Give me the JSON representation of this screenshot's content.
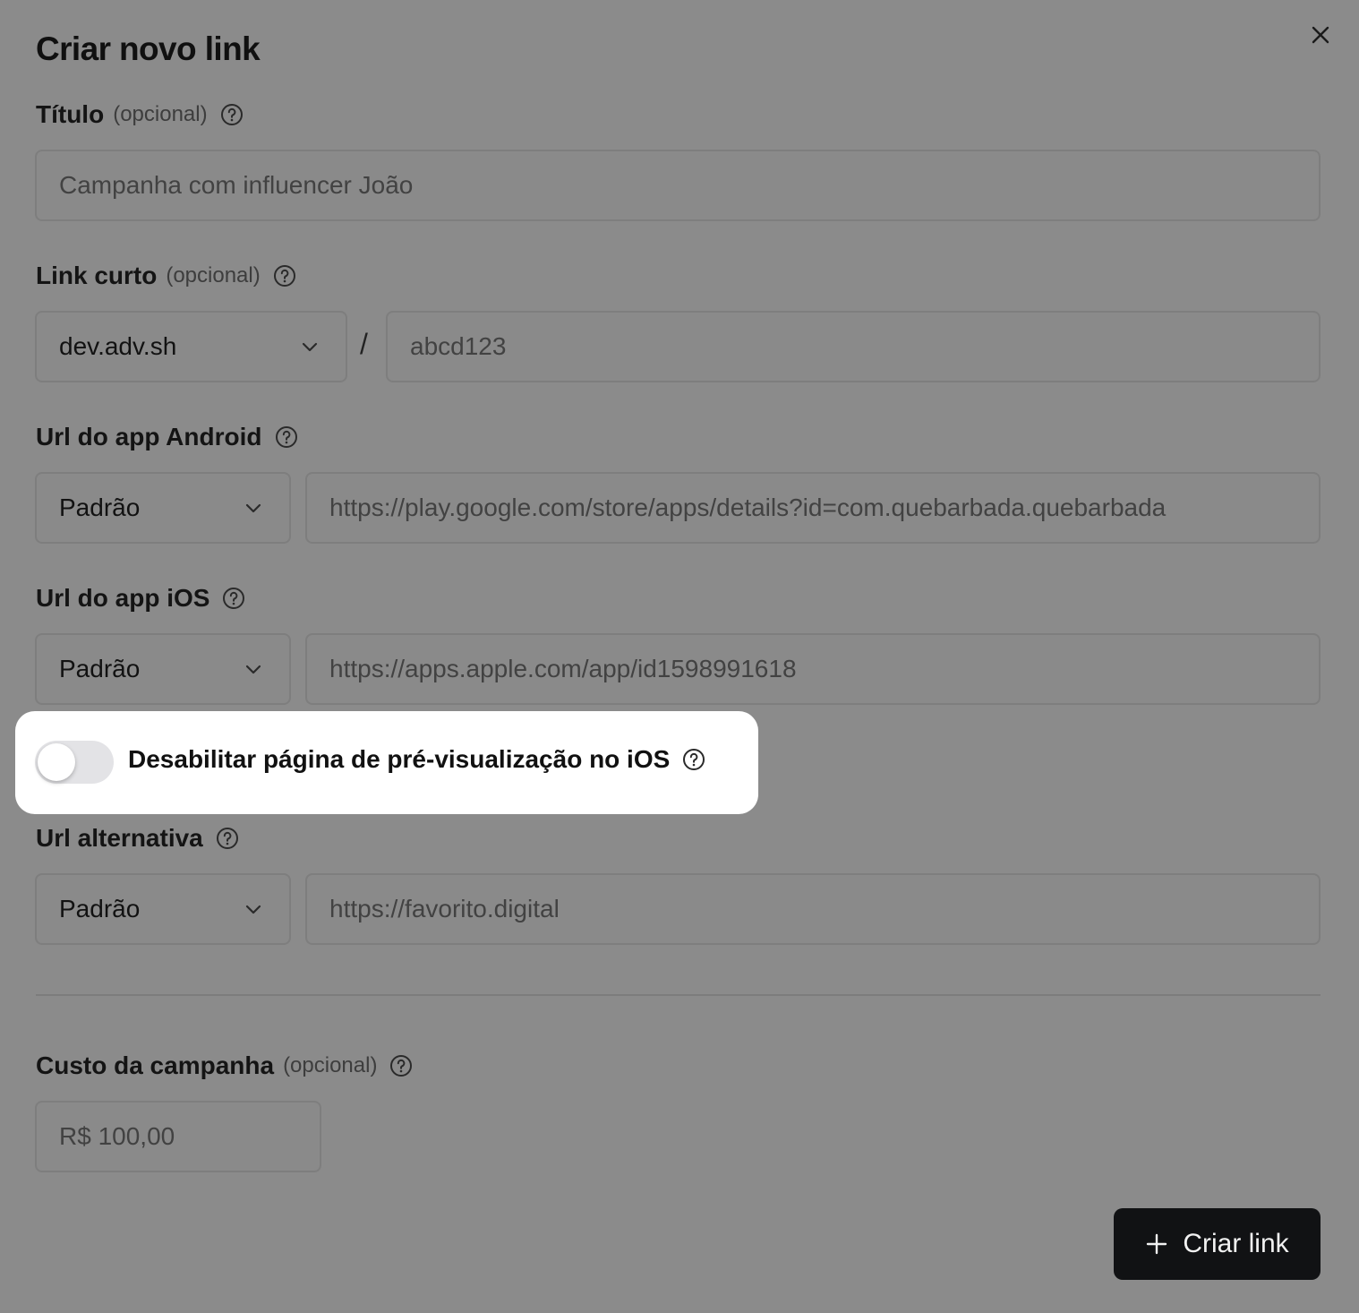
{
  "dialog": {
    "title": "Criar novo link",
    "close_icon": "close-icon"
  },
  "fields": {
    "titulo": {
      "label": "Título",
      "optional": "(opcional)",
      "placeholder": "Campanha com influencer João"
    },
    "link_curto": {
      "label": "Link curto",
      "optional": "(opcional)",
      "domain": "dev.adv.sh",
      "separator": "/",
      "placeholder": "abcd123"
    },
    "android": {
      "label": "Url do app Android",
      "mode": "Padrão",
      "placeholder": "https://play.google.com/store/apps/details?id=com.quebarbada.quebarbada"
    },
    "ios": {
      "label": "Url do app iOS",
      "mode": "Padrão",
      "placeholder": "https://apps.apple.com/app/id1598991618"
    },
    "ios_preview_toggle": {
      "label": "Desabilitar página de pré-visualização no iOS",
      "enabled": false
    },
    "alternativa": {
      "label": "Url alternativa",
      "mode": "Padrão",
      "placeholder": "https://favorito.digital"
    },
    "custo": {
      "label": "Custo da campanha",
      "optional": "(opcional)",
      "placeholder": "R$ 100,00"
    }
  },
  "actions": {
    "create_label": "Criar link",
    "create_icon": "plus-icon"
  },
  "colors": {
    "overlay": "#8b8b8b",
    "button": "#111214",
    "highlight": "#ffffff",
    "toggle_off": "#e3e3e6"
  }
}
